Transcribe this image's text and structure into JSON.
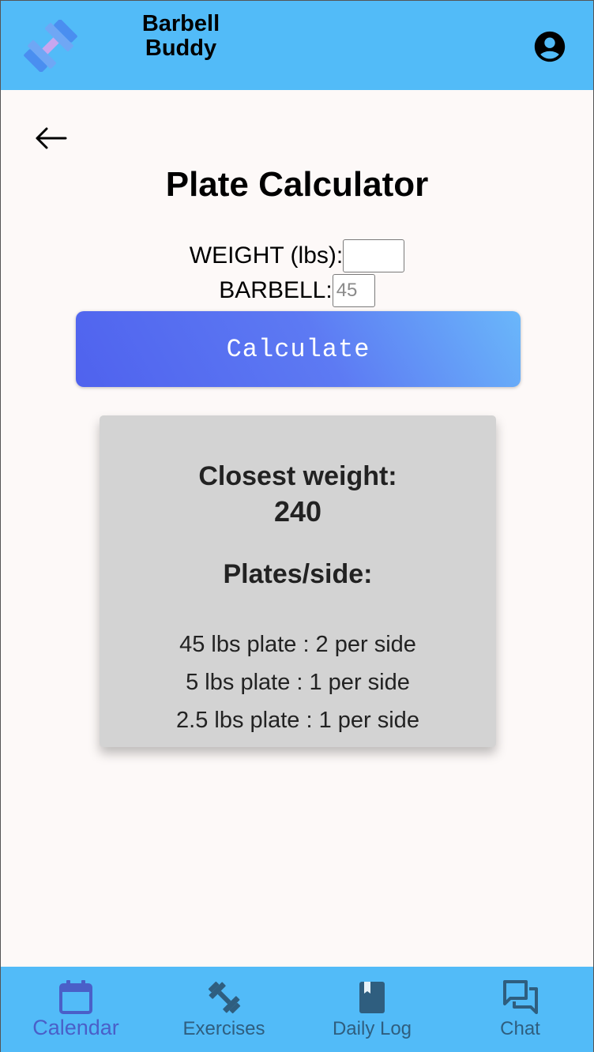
{
  "header": {
    "app_name_line1": "Barbell",
    "app_name_line2": "Buddy",
    "logo_icon": "dumbbell-logo",
    "account_icon": "account-circle-icon"
  },
  "page": {
    "back_icon": "arrow-left-icon",
    "title": "Plate Calculator"
  },
  "form": {
    "weight_label": "WEIGHT (lbs):",
    "weight_value": "",
    "barbell_label": "BARBELL:",
    "barbell_placeholder": "45",
    "calculate_label": "Calculate"
  },
  "result": {
    "closest_label": "Closest weight:",
    "closest_value": "240",
    "plates_label": "Plates/side:",
    "plates": [
      "45 lbs plate : 2 per side",
      "5 lbs plate : 1 per side",
      "2.5 lbs plate : 1 per side"
    ]
  },
  "nav": {
    "active": "Calendar",
    "items": [
      {
        "label": "Calendar",
        "icon": "calendar-icon"
      },
      {
        "label": "Exercises",
        "icon": "dumbbell-icon"
      },
      {
        "label": "Daily Log",
        "icon": "book-icon"
      },
      {
        "label": "Chat",
        "icon": "chat-icon"
      }
    ]
  },
  "colors": {
    "header_bg": "#52bbf8",
    "active_nav": "#4a5fc8",
    "inactive_nav": "#2f5e7f",
    "card_bg": "#d3d3d3"
  }
}
